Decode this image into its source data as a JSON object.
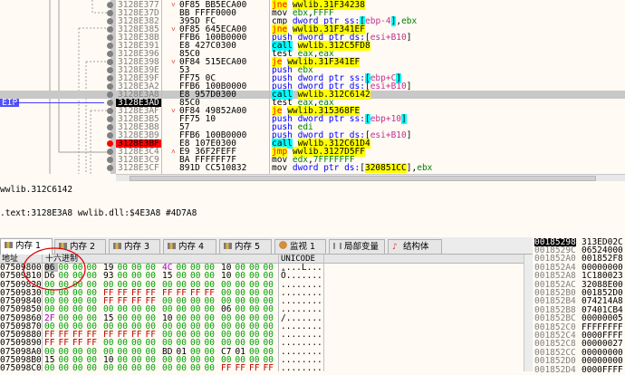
{
  "disasm": {
    "eip_label": "EIP",
    "rows": [
      {
        "addr": "3128E377",
        "arrow": "˅",
        "bytes": "0F85 BB5ECA00",
        "ins": [
          [
            "jne",
            "jcc"
          ],
          [
            " ",
            "plain"
          ],
          [
            "wwlib.31F34238",
            "jaddr"
          ]
        ]
      },
      {
        "addr": "3128E37D",
        "arrow": "",
        "bytes": "BB FFFF0000",
        "ins": [
          [
            "mov ",
            "plain"
          ],
          [
            "ebx",
            "grn"
          ],
          [
            ",",
            "plain"
          ],
          [
            "FFFF",
            "grn"
          ]
        ]
      },
      {
        "addr": "3128E382",
        "arrow": "",
        "bytes": "395D FC",
        "ins": [
          [
            "cmp ",
            "plain"
          ],
          [
            "dword ptr ",
            "blue"
          ],
          [
            "ss:",
            "blue"
          ],
          [
            "[",
            "br"
          ],
          [
            "ebp-4",
            "mag"
          ],
          [
            "]",
            "br"
          ],
          [
            ",",
            "plain"
          ],
          [
            "ebx",
            "grn"
          ]
        ]
      },
      {
        "addr": "3128E385",
        "arrow": "˅",
        "bytes": "0F85 645ECA00",
        "ins": [
          [
            "jne",
            "jcc"
          ],
          [
            " ",
            "plain"
          ],
          [
            "wwlib.31F341EF",
            "jaddr"
          ]
        ]
      },
      {
        "addr": "3128E38B",
        "arrow": "",
        "bytes": "FFB6 100B0000",
        "ins": [
          [
            "push dword ptr ds:",
            "blue"
          ],
          [
            "[",
            "plain"
          ],
          [
            "esi+B10",
            "mag"
          ],
          [
            "]",
            "plain"
          ]
        ]
      },
      {
        "addr": "3128E391",
        "arrow": "",
        "bytes": "E8 427C0300",
        "ins": [
          [
            "call",
            "call"
          ],
          [
            " ",
            "plain"
          ],
          [
            "wwlib.312C5FD8",
            "jaddr"
          ]
        ]
      },
      {
        "addr": "3128E396",
        "arrow": "",
        "bytes": "85C0",
        "ins": [
          [
            "test ",
            "plain"
          ],
          [
            "eax",
            "grn"
          ],
          [
            ",",
            "plain"
          ],
          [
            "eax",
            "grn"
          ]
        ]
      },
      {
        "addr": "3128E398",
        "arrow": "˅",
        "bytes": "0F84 515ECA00",
        "ins": [
          [
            "je",
            "jcc"
          ],
          [
            " ",
            "plain"
          ],
          [
            "wwlib.31F341EF",
            "jaddr"
          ]
        ]
      },
      {
        "addr": "3128E39E",
        "arrow": "",
        "bytes": "53",
        "ins": [
          [
            "push ",
            "blue"
          ],
          [
            "ebx",
            "grn"
          ]
        ]
      },
      {
        "addr": "3128E39F",
        "arrow": "",
        "bytes": "FF75 0C",
        "ins": [
          [
            "push dword ptr ss:",
            "blue"
          ],
          [
            "[",
            "br"
          ],
          [
            "ebp+C",
            "mag"
          ],
          [
            "]",
            "br"
          ]
        ]
      },
      {
        "addr": "3128E3A2",
        "arrow": "",
        "bytes": "FFB6 100B0000",
        "ins": [
          [
            "push dword ptr ds:",
            "blue"
          ],
          [
            "[",
            "plain"
          ],
          [
            "esi+B10",
            "mag"
          ],
          [
            "]",
            "plain"
          ]
        ]
      },
      {
        "addr": "3128E3A8",
        "arrow": "",
        "bytes": "E8 957D0300",
        "ins": [
          [
            "call",
            "call"
          ],
          [
            " ",
            "plain"
          ],
          [
            "wwlib.312C6142",
            "jaddr"
          ]
        ],
        "state": "selected"
      },
      {
        "addr": "3128E3AD",
        "arrow": "",
        "bytes": "85C0",
        "ins": [
          [
            "test ",
            "plain"
          ],
          [
            "eax",
            "grn"
          ],
          [
            ",",
            "plain"
          ],
          [
            "eax",
            "grn"
          ]
        ],
        "state": "eip"
      },
      {
        "addr": "3128E3AF",
        "arrow": "˅",
        "bytes": "0F84 49852A00",
        "ins": [
          [
            "je",
            "jcc"
          ],
          [
            " ",
            "plain"
          ],
          [
            "wwlib.315368FE",
            "jaddr"
          ]
        ]
      },
      {
        "addr": "3128E3B5",
        "arrow": "",
        "bytes": "FF75 10",
        "ins": [
          [
            "push dword ptr ss:",
            "blue"
          ],
          [
            "[",
            "br"
          ],
          [
            "ebp+10",
            "mag"
          ],
          [
            "]",
            "br"
          ]
        ]
      },
      {
        "addr": "3128E3B8",
        "arrow": "",
        "bytes": "57",
        "ins": [
          [
            "push ",
            "blue"
          ],
          [
            "edi",
            "grn"
          ]
        ]
      },
      {
        "addr": "3128E3B9",
        "arrow": "",
        "bytes": "FFB6 100B0000",
        "ins": [
          [
            "push dword ptr ds:",
            "blue"
          ],
          [
            "[",
            "plain"
          ],
          [
            "esi+B10",
            "mag"
          ],
          [
            "]",
            "plain"
          ]
        ]
      },
      {
        "addr": "3128E3BF",
        "arrow": "",
        "bytes": "E8 107E0300",
        "ins": [
          [
            "call",
            "call"
          ],
          [
            " ",
            "plain"
          ],
          [
            "wwlib.312C61D4",
            "jaddr"
          ]
        ],
        "state": "breakpoint"
      },
      {
        "addr": "3128E3C4",
        "arrow": "˄",
        "bytes": "E9 36F2FEFF",
        "ins": [
          [
            "jmp",
            "jcc"
          ],
          [
            " ",
            "plain"
          ],
          [
            "wwlib.3127D5FF",
            "jaddr"
          ]
        ]
      },
      {
        "addr": "3128E3C9",
        "arrow": "",
        "bytes": "BA FFFFFF7F",
        "ins": [
          [
            "mov ",
            "plain"
          ],
          [
            "edx",
            "grn"
          ],
          [
            ",",
            "plain"
          ],
          [
            "7FFFFFFF",
            "grn"
          ]
        ]
      },
      {
        "addr": "3128E3CF",
        "arrow": "",
        "bytes": "891D CC510832",
        "ins": [
          [
            "mov ",
            "plain"
          ],
          [
            "dword ptr ds:",
            "blue"
          ],
          [
            "[",
            "plain"
          ],
          [
            "320851CC",
            "jaddr"
          ],
          [
            "]",
            "plain"
          ],
          [
            ",",
            "plain"
          ],
          [
            "ebx",
            "grn"
          ]
        ]
      }
    ]
  },
  "info": {
    "line1": "wwlib.312C6142",
    "line2": ".text:3128E3A8 wwlib.dll:$4E3A8 #4D7A8"
  },
  "tabs": [
    {
      "label": "内存 1",
      "active": true
    },
    {
      "label": "内存 2"
    },
    {
      "label": "内存 3"
    },
    {
      "label": "内存 4"
    },
    {
      "label": "内存 5"
    },
    {
      "label": "监视 1"
    },
    {
      "label": "局部变量"
    },
    {
      "label": "结构体"
    }
  ],
  "memory": {
    "headers": {
      "address": "地址",
      "hex": "十六进制",
      "unicode": "UNICODE"
    },
    "rows": [
      {
        "addr": "07509800",
        "hex": "06 00 00 00 19 00 00 00 4C 00 00 00 10 00 00 00",
        "uni": "....L..."
      },
      {
        "addr": "07509810",
        "hex": "D6 00 00 00 93 00 00 00 15 00 00 00 10 00 00 00",
        "uni": "Ö......."
      },
      {
        "addr": "07509820",
        "hex": "00 00 00 00 00 00 00 00 00 00 00 00 00 00 00 00",
        "uni": "........"
      },
      {
        "addr": "07509830",
        "hex": "00 00 00 00 FF FF FF FF FF FF FF FF 00 00 00 00",
        "uni": "........"
      },
      {
        "addr": "07509840",
        "hex": "00 00 00 00 FF FF FF FF 00 00 00 00 00 00 00 00",
        "uni": "........"
      },
      {
        "addr": "07509850",
        "hex": "00 00 00 00 00 00 00 00 00 00 00 00 06 00 00 00",
        "uni": "........"
      },
      {
        "addr": "07509860",
        "hex": "2F 00 00 00 15 00 00 00 10 00 00 00 00 00 00 00",
        "uni": "/......."
      },
      {
        "addr": "07509870",
        "hex": "00 00 00 00 00 00 00 00 00 00 00 00 00 00 00 00",
        "uni": "........"
      },
      {
        "addr": "07509880",
        "hex": "FF FF FF FF FF FF FF FF 00 00 00 00 00 00 00 00",
        "uni": "........"
      },
      {
        "addr": "07509890",
        "hex": "FF FF FF FF 00 00 00 00 00 00 00 00 00 00 00 00",
        "uni": "........"
      },
      {
        "addr": "075098A0",
        "hex": "00 00 00 00 00 00 00 00 BD 01 00 00 C7 01 00 00",
        "uni": "........"
      },
      {
        "addr": "075098B0",
        "hex": "15 00 00 00 10 00 00 00 00 00 00 00 00 00 00 00",
        "uni": "........"
      },
      {
        "addr": "075098C0",
        "hex": "00 00 00 00 00 00 00 00 00 00 00 00 FF FF FF FF",
        "uni": "........"
      }
    ]
  },
  "stack": {
    "rows": [
      {
        "addr": "00185298",
        "val": "313ED02C",
        "current": true
      },
      {
        "addr": "0018529C",
        "val": "06524000"
      },
      {
        "addr": "001852A0",
        "val": "001852F8"
      },
      {
        "addr": "001852A4",
        "val": "00000000"
      },
      {
        "addr": "001852A8",
        "val": "1C180023"
      },
      {
        "addr": "001852AC",
        "val": "32088E00"
      },
      {
        "addr": "001852B0",
        "val": "001852D0"
      },
      {
        "addr": "001852B4",
        "val": "074214A8"
      },
      {
        "addr": "001852B8",
        "val": "07401CB4"
      },
      {
        "addr": "001852BC",
        "val": "00000005"
      },
      {
        "addr": "001852C0",
        "val": "FFFFFFFF"
      },
      {
        "addr": "001852C4",
        "val": "0000FFFF"
      },
      {
        "addr": "001852C8",
        "val": "00000027"
      },
      {
        "addr": "001852CC",
        "val": "00000000"
      },
      {
        "addr": "001852D0",
        "val": "00000000"
      },
      {
        "addr": "001852D4",
        "val": "0000FFFF"
      }
    ]
  },
  "colors": {
    "eip": "#4040ff",
    "breakpoint": "#ff0000",
    "jump_highlight": "#ffff00",
    "call_highlight": "#00ffff",
    "annotation": "#e00000"
  }
}
